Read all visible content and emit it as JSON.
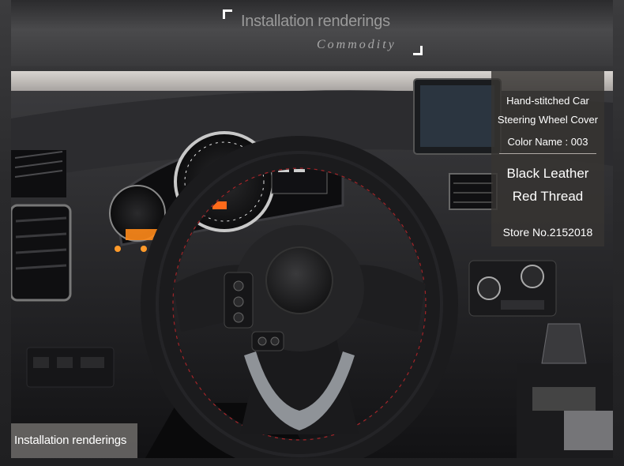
{
  "header": {
    "title": "Installation renderings",
    "subtitle": "Commodity"
  },
  "info_box": {
    "line1": "Hand-stitched Car",
    "line2": "Steering Wheel Cover",
    "line3": "Color Name : 003",
    "line4": "Black Leather",
    "line5": "Red Thread",
    "store": "Store No.2152018"
  },
  "caption": "Installation renderings",
  "colors": {
    "leather": "#1b1b1d",
    "stitch": "#b3262a",
    "trim": "#9a9ea3",
    "dash": "#141416"
  }
}
